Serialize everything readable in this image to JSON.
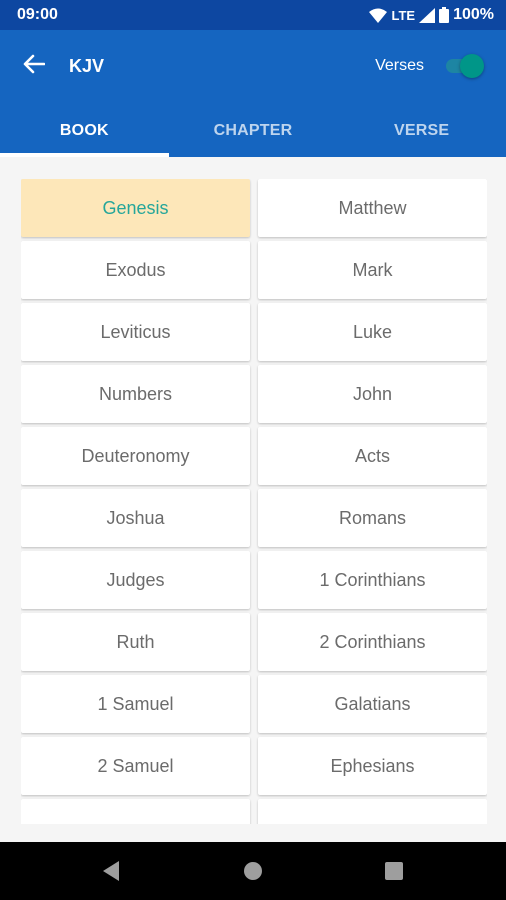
{
  "status_bar": {
    "time": "09:00",
    "network": "LTE",
    "battery": "100%"
  },
  "app_bar": {
    "title": "KJV",
    "verses_label": "Verses",
    "verses_toggle_on": true
  },
  "tabs": [
    {
      "label": "BOOK",
      "active": true
    },
    {
      "label": "CHAPTER",
      "active": false
    },
    {
      "label": "VERSE",
      "active": false
    }
  ],
  "books": {
    "selected": "Genesis",
    "old_testament": [
      "Genesis",
      "Exodus",
      "Leviticus",
      "Numbers",
      "Deuteronomy",
      "Joshua",
      "Judges",
      "Ruth",
      "1 Samuel",
      "2 Samuel"
    ],
    "new_testament": [
      "Matthew",
      "Mark",
      "Luke",
      "John",
      "Acts",
      "Romans",
      "1 Corinthians",
      "2 Corinthians",
      "Galatians",
      "Ephesians"
    ]
  },
  "colors": {
    "status_bar": "#0d47a1",
    "app_bar": "#1565c0",
    "accent": "#009688",
    "selected_bg": "#fde7b9",
    "selected_text": "#26a69a"
  }
}
